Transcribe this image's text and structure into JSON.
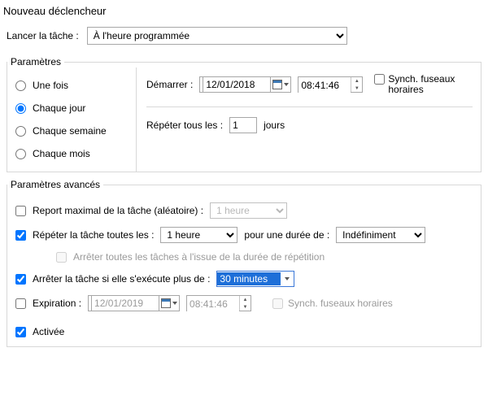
{
  "window": {
    "title": "Nouveau déclencheur"
  },
  "launch": {
    "label": "Lancer la tâche :",
    "value": "À l'heure programmée"
  },
  "params": {
    "legend": "Paramètres",
    "radios": {
      "once": "Une fois",
      "daily": "Chaque jour",
      "weekly": "Chaque semaine",
      "monthly": "Chaque mois",
      "selected": "daily"
    },
    "start_label": "Démarrer :",
    "date": "12/01/2018",
    "time": "08:41:46",
    "sync_tz": "Synch. fuseaux horaires",
    "repeat_label": "Répéter tous les :",
    "repeat_value": "1",
    "repeat_unit": "jours"
  },
  "advanced": {
    "legend": "Paramètres avancés",
    "delay_label": "Report maximal de la tâche (aléatoire) :",
    "delay_value": "1 heure",
    "repeat_label": "Répéter la tâche toutes les :",
    "repeat_value": "1 heure",
    "repeat_for_label": "pour une durée de :",
    "repeat_for_value": "Indéfiniment",
    "stop_all_label": "Arrêter toutes les tâches à l'issue de la durée de répétition",
    "stop_if_label": "Arrêter la tâche si elle s'exécute plus de :",
    "stop_if_value": "30 minutes",
    "expire_label": "Expiration :",
    "expire_date": "12/01/2019",
    "expire_time": "08:41:46",
    "expire_sync": "Synch. fuseaux horaires",
    "enabled_label": "Activée"
  }
}
